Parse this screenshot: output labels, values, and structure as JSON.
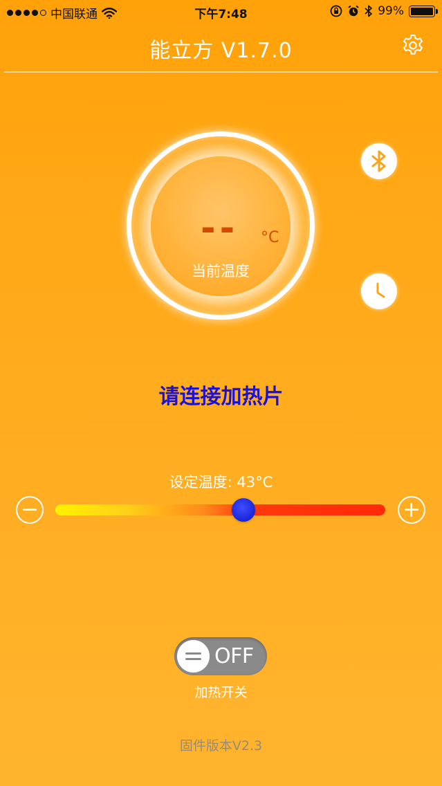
{
  "status_bar": {
    "carrier": "中国联通",
    "time": "下午7:48",
    "battery": "99%",
    "battery_level": 0.99
  },
  "nav": {
    "title": "能立方 V1.7.0",
    "settings_icon": "gear-icon"
  },
  "dial": {
    "value": "--",
    "unit": "°C",
    "label": "当前温度"
  },
  "side_buttons": {
    "bluetooth_icon": "bluetooth-icon",
    "timer_icon": "clock-icon"
  },
  "connect_prompt": "请连接加热片",
  "setpoint": {
    "label": "设定温度: 43°C",
    "level_fraction": 0.57
  },
  "heating_switch": {
    "state": "OFF",
    "label": "加热开关"
  },
  "firmware": "固件版本V2.3",
  "colors": {
    "background": "#ffa60f",
    "temperature_value": "#d24a00",
    "prompt": "#1b12d4",
    "slider_thumb": "#2430e6",
    "toggle_off": "#8a8a8a"
  }
}
